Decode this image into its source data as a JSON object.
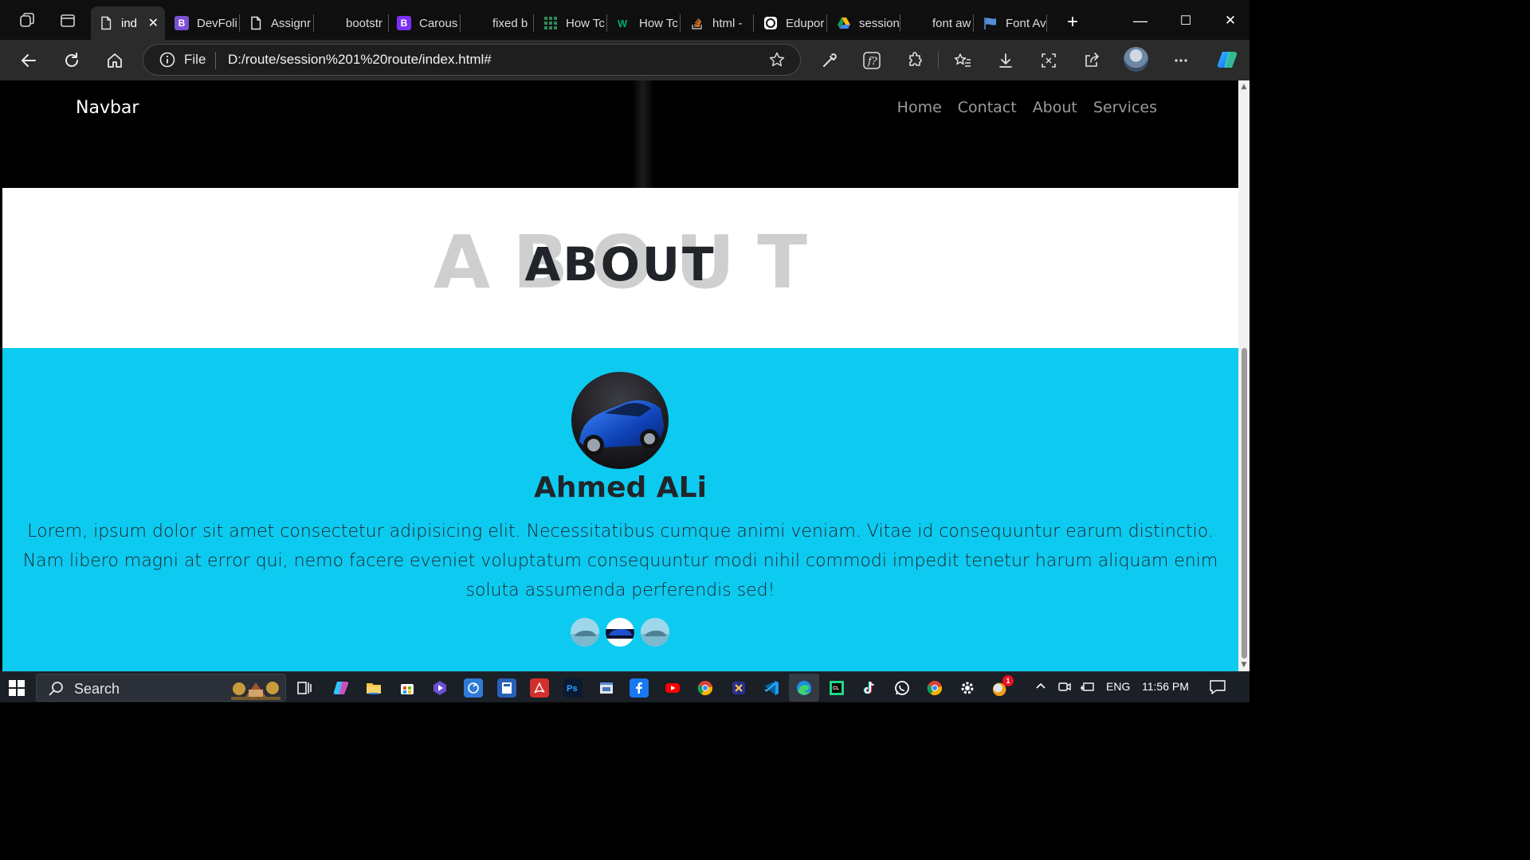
{
  "browser": {
    "tabs": [
      {
        "label": "ind",
        "favicon": "page-icon",
        "active": true
      },
      {
        "label": "DevFoli",
        "favicon": "bootstrap-icon",
        "color": "#7b4fd1"
      },
      {
        "label": "Assignr",
        "favicon": "page-icon"
      },
      {
        "label": "bootstr",
        "favicon": "blank-icon"
      },
      {
        "label": "Carous",
        "favicon": "bootstrap-icon",
        "color": "#7b2ff7"
      },
      {
        "label": "fixed b",
        "favicon": "blank-icon"
      },
      {
        "label": "How Tc",
        "favicon": "w3-grid-icon",
        "color": "#2e8b57"
      },
      {
        "label": "How Tc",
        "favicon": "w3schools-icon",
        "color": "#04aa6d"
      },
      {
        "label": "html -",
        "favicon": "stackoverflow-icon",
        "color": "#f48024"
      },
      {
        "label": "Edupor",
        "favicon": "edu-icon",
        "color": "#ffffff"
      },
      {
        "label": "session",
        "favicon": "google-drive-icon"
      },
      {
        "label": "font aw",
        "favicon": "blank-icon"
      },
      {
        "label": "Font Av",
        "favicon": "fontawesome-flag-icon",
        "color": "#538dd7"
      }
    ],
    "new_tab_label": "+",
    "address": {
      "scheme_label": "File",
      "url": "D:/route/session%201%20route/index.html#"
    },
    "window_controls": {
      "minimize": "—",
      "maximize": "☐",
      "close": "✕"
    }
  },
  "page": {
    "navbar": {
      "brand": "Navbar",
      "links": [
        "Home",
        "Contact",
        "About",
        "Services"
      ]
    },
    "about": {
      "background_word": "ABOUT",
      "title": "ABOUT"
    },
    "testimonial": {
      "name": "Ahmed ALi",
      "text": "Lorem, ipsum dolor sit amet consectetur adipisicing elit. Necessitatibus cumque animi veniam. Vitae id consequuntur earum distinctio. Nam libero magni at error qui, nemo facere eveniet voluptatum consequuntur modi nihil commodi impedit tenetur harum aliquam enim soluta assumenda perferendis sed!",
      "indicator_count": 3,
      "active_indicator": 2
    },
    "colors": {
      "section_bg": "#0dcaf0",
      "hero_bg": "#000000",
      "title_text": "#212529",
      "watermark_text": "#cfcfcf"
    }
  },
  "taskbar": {
    "search_label": "Search",
    "apps": [
      "task-view-icon",
      "copilot-icon",
      "file-explorer-icon",
      "store-icon",
      "clipchamp-icon",
      "recycle-icon",
      "calculator-icon",
      "acrobat-icon",
      "photoshop-icon",
      "window-app-icon",
      "facebook-icon",
      "youtube-icon",
      "chrome-icon",
      "snip-icon",
      "vscode-icon",
      "edge-icon",
      "clion-icon",
      "tiktok-icon",
      "whatsapp-icon",
      "chrome-icon",
      "settings-icon",
      "notification-app-icon"
    ],
    "notification_badge": "1",
    "language": "ENG",
    "time": "11:56 PM"
  }
}
